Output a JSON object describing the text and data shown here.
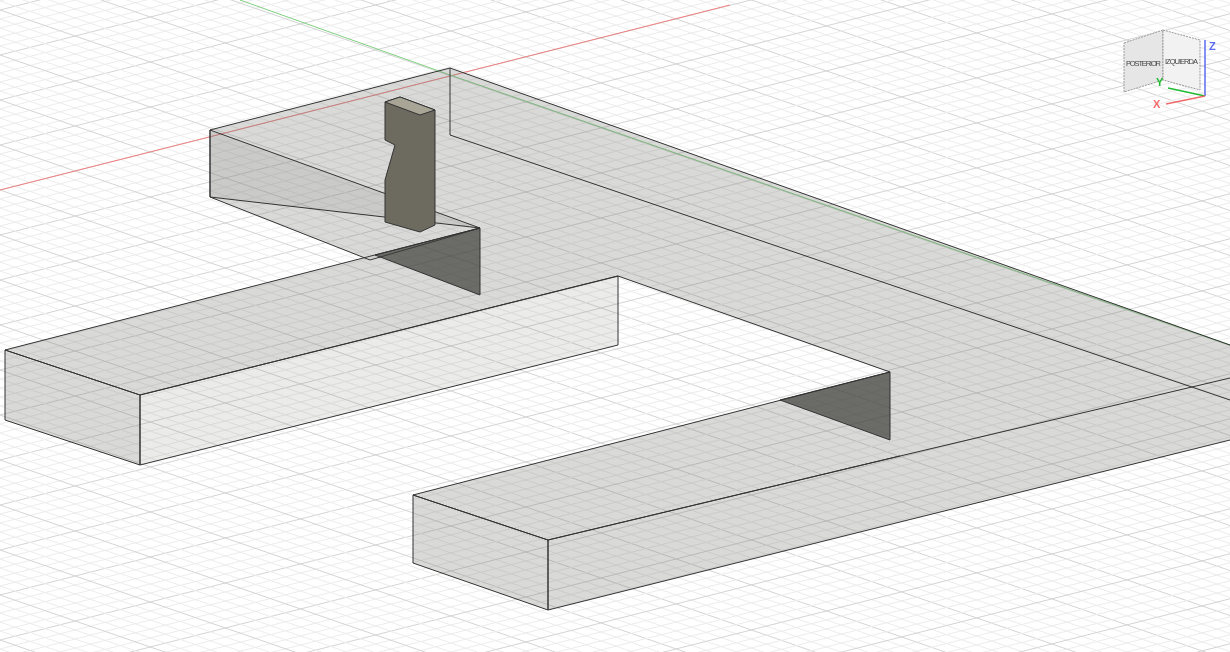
{
  "viewport": {
    "view_cube": {
      "faces": [
        "POSTERIOR",
        "IZQUIERDA"
      ],
      "axes": [
        {
          "label": "Z",
          "color": "#5a6cf0"
        },
        {
          "label": "Y",
          "color": "#22bb33"
        },
        {
          "label": "X",
          "color": "#f06a6a"
        }
      ]
    }
  }
}
